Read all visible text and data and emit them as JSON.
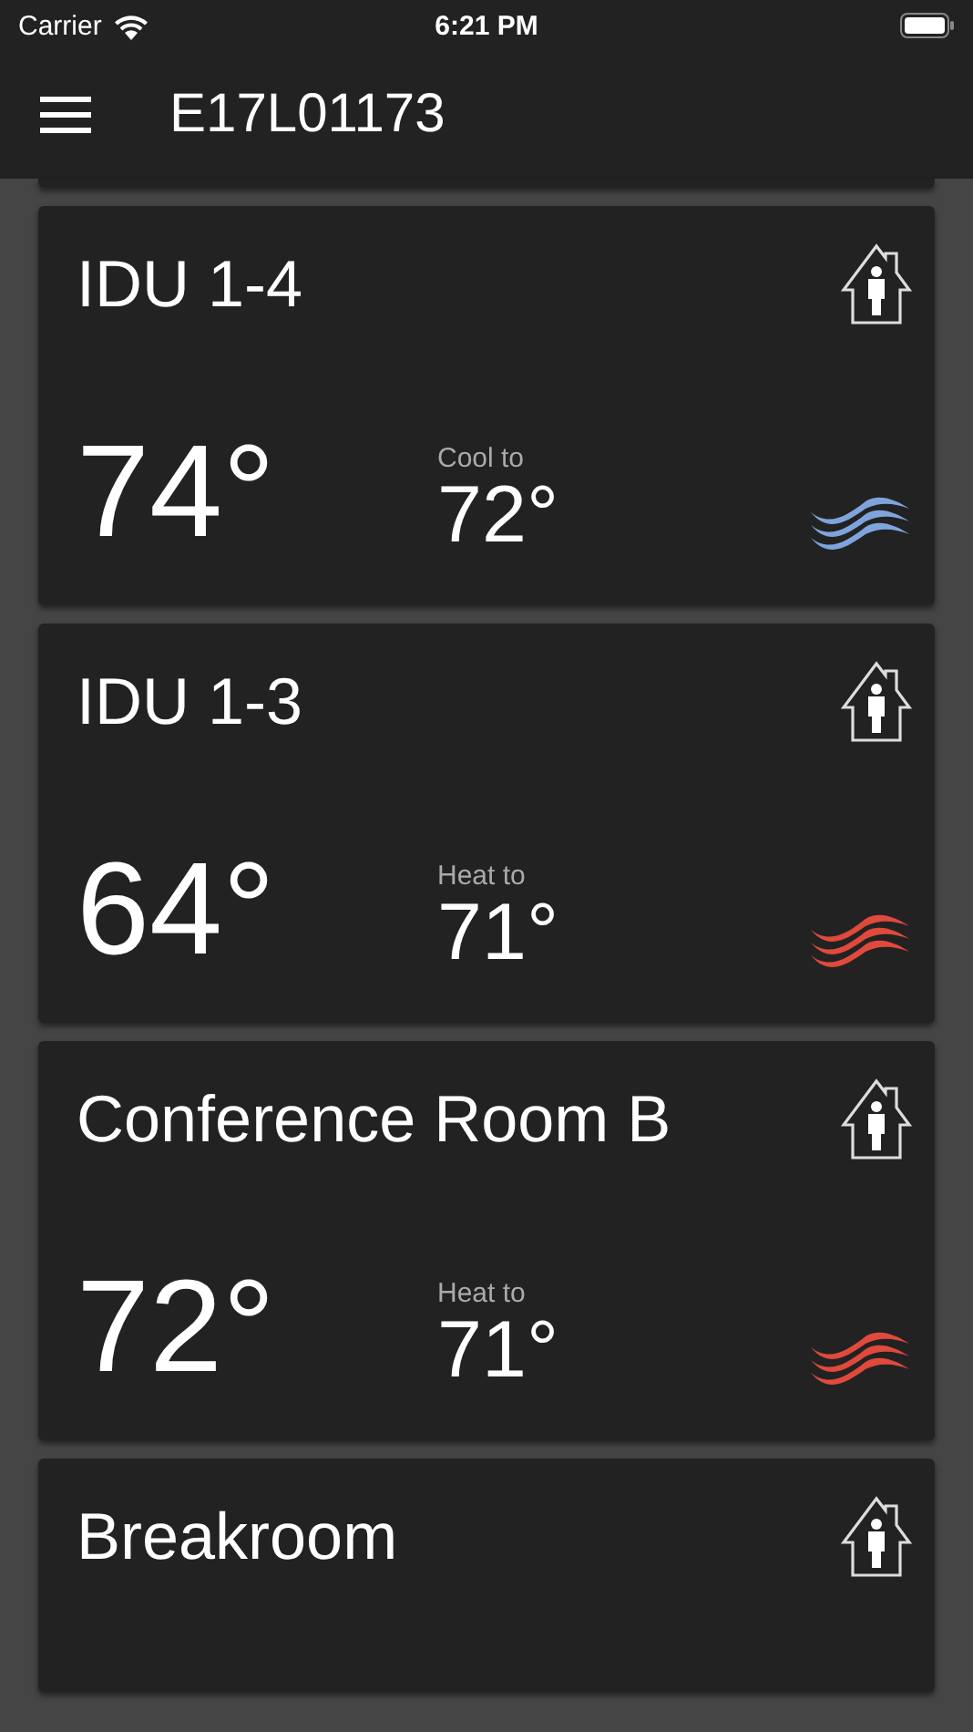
{
  "status_bar": {
    "carrier": "Carrier",
    "time": "6:21 PM"
  },
  "header": {
    "title": "E17L01173"
  },
  "zones": [
    {
      "name": "IDU 1-4",
      "temp": "74°",
      "kind": "cool",
      "setpoint_label": "Cool to",
      "setpoint": "72°"
    },
    {
      "name": "IDU 1-3",
      "temp": "64°",
      "kind": "heat",
      "setpoint_label": "Heat to",
      "setpoint": "71°"
    },
    {
      "name": "Conference Room B",
      "temp": "72°",
      "kind": "heat",
      "setpoint_label": "Heat to",
      "setpoint": "71°"
    },
    {
      "name": "Breakroom"
    }
  ]
}
